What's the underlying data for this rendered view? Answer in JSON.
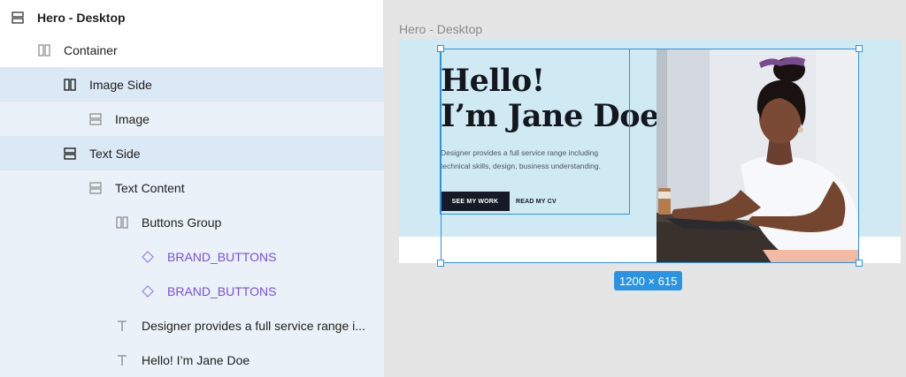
{
  "layers": [
    {
      "label": "Hero - Desktop",
      "icon": "frame-icon"
    },
    {
      "label": "Container",
      "icon": "horizontal-autolayout-icon"
    },
    {
      "label": "Image Side",
      "icon": "horizontal-autolayout-icon"
    },
    {
      "label": "Image",
      "icon": "vertical-autolayout-icon"
    },
    {
      "label": "Text Side",
      "icon": "vertical-autolayout-icon"
    },
    {
      "label": "Text Content",
      "icon": "vertical-autolayout-icon"
    },
    {
      "label": "Buttons Group",
      "icon": "horizontal-autolayout-icon"
    },
    {
      "label": "BRAND_BUTTONS",
      "icon": "component-instance-icon"
    },
    {
      "label": "BRAND_BUTTONS",
      "icon": "component-instance-icon"
    },
    {
      "label": "Designer provides a full service range i...",
      "icon": "text-icon"
    },
    {
      "label": "Hello! I’m Jane Doe",
      "icon": "text-icon"
    }
  ],
  "canvas": {
    "frame_label": "Hero - Desktop",
    "size_badge": "1200 × 615",
    "hero": {
      "heading_line1": "Hello!",
      "heading_line2": "I’m Jane Doe",
      "description_line1": "Designer provides a full service range including",
      "description_line2": "technical skills, design, business understanding.",
      "primary_button": "SEE MY WORK",
      "secondary_button": "READ MY CV"
    }
  },
  "colors": {
    "selection_blue": "#2a94e2",
    "component_purple": "#7b4fdc",
    "hero_background": "#cfeaf3",
    "dark_button": "#151a26"
  }
}
